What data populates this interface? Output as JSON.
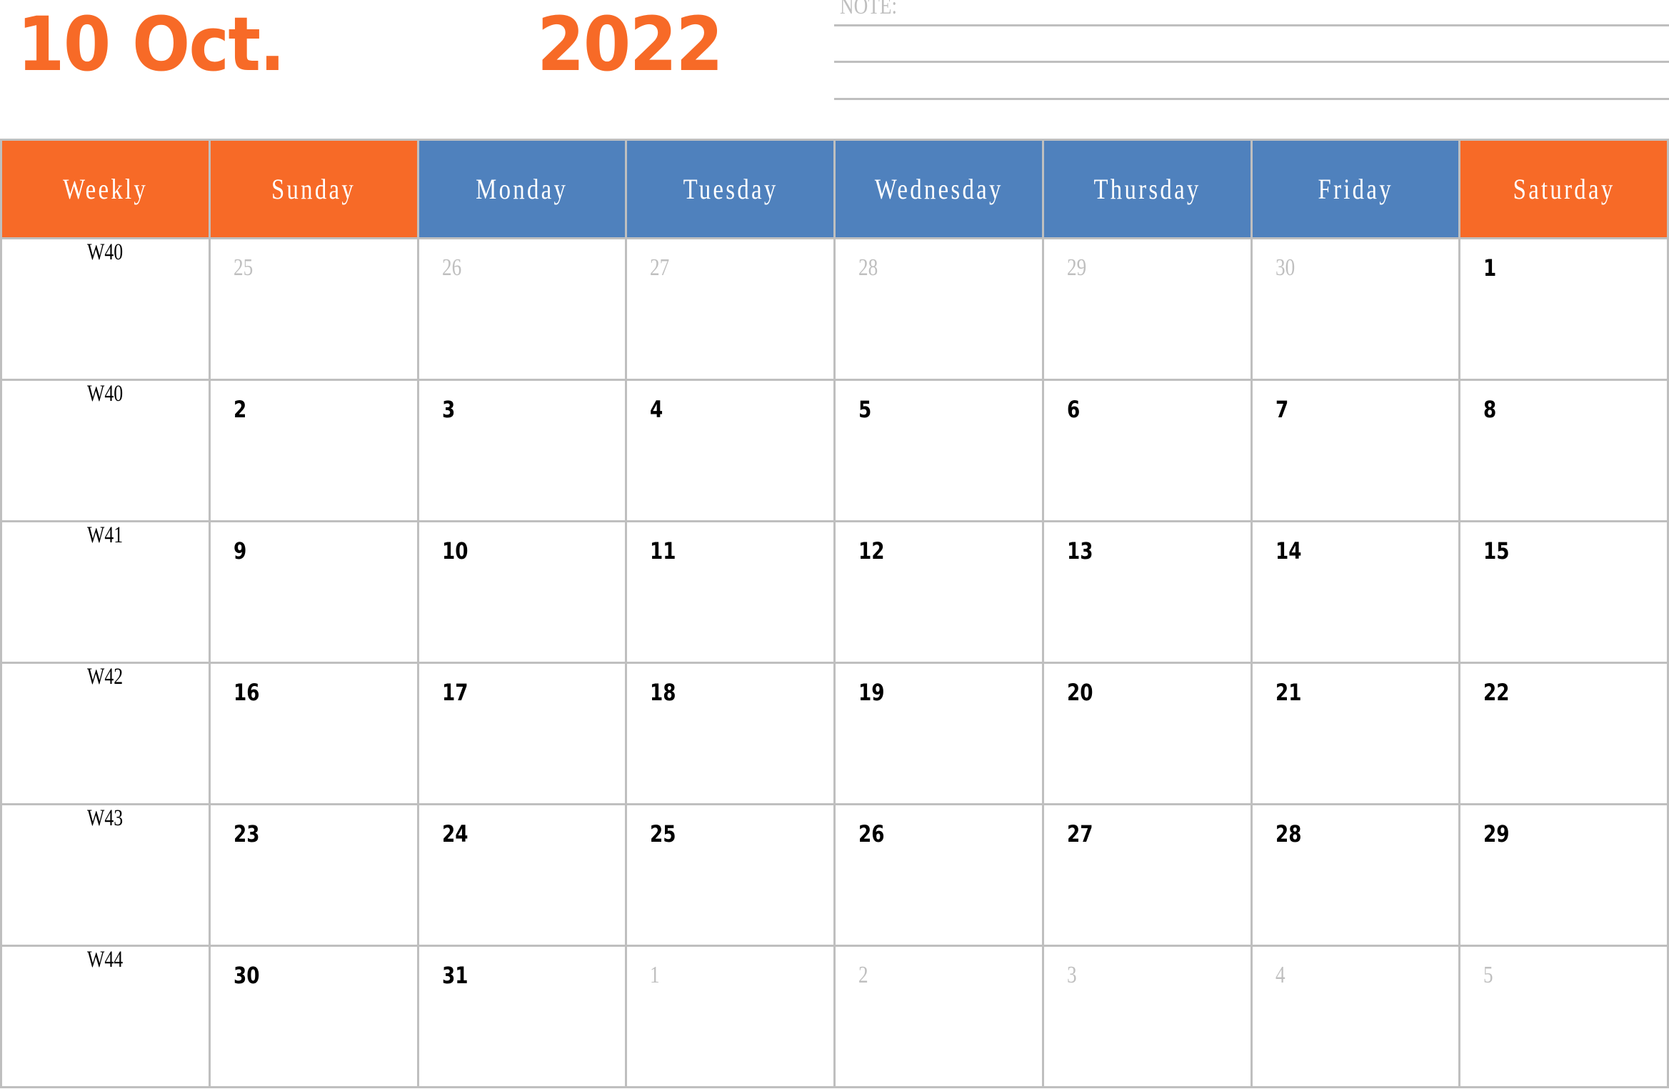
{
  "header": {
    "month_label": "10 Oct.",
    "year_label": "2022",
    "note_label": "NOTE:"
  },
  "colors": {
    "accent_orange": "#F76A27",
    "accent_blue": "#4F81BD",
    "grid_gray": "#BFBFBF",
    "out_of_month_text": "#BFBFBF"
  },
  "columns": [
    {
      "label": "Weekly",
      "color": "orange"
    },
    {
      "label": "Sunday",
      "color": "orange"
    },
    {
      "label": "Monday",
      "color": "blue"
    },
    {
      "label": "Tuesday",
      "color": "blue"
    },
    {
      "label": "Wednesday",
      "color": "blue"
    },
    {
      "label": "Thursday",
      "color": "blue"
    },
    {
      "label": "Friday",
      "color": "blue"
    },
    {
      "label": "Saturday",
      "color": "orange"
    }
  ],
  "weeks": [
    {
      "week": "W40",
      "days": [
        {
          "d": "25",
          "in_month": false
        },
        {
          "d": "26",
          "in_month": false
        },
        {
          "d": "27",
          "in_month": false
        },
        {
          "d": "28",
          "in_month": false
        },
        {
          "d": "29",
          "in_month": false
        },
        {
          "d": "30",
          "in_month": false
        },
        {
          "d": "1",
          "in_month": true
        }
      ]
    },
    {
      "week": "W40",
      "days": [
        {
          "d": "2",
          "in_month": true
        },
        {
          "d": "3",
          "in_month": true
        },
        {
          "d": "4",
          "in_month": true
        },
        {
          "d": "5",
          "in_month": true
        },
        {
          "d": "6",
          "in_month": true
        },
        {
          "d": "7",
          "in_month": true
        },
        {
          "d": "8",
          "in_month": true
        }
      ]
    },
    {
      "week": "W41",
      "days": [
        {
          "d": "9",
          "in_month": true
        },
        {
          "d": "10",
          "in_month": true
        },
        {
          "d": "11",
          "in_month": true
        },
        {
          "d": "12",
          "in_month": true
        },
        {
          "d": "13",
          "in_month": true
        },
        {
          "d": "14",
          "in_month": true
        },
        {
          "d": "15",
          "in_month": true
        }
      ]
    },
    {
      "week": "W42",
      "days": [
        {
          "d": "16",
          "in_month": true
        },
        {
          "d": "17",
          "in_month": true
        },
        {
          "d": "18",
          "in_month": true
        },
        {
          "d": "19",
          "in_month": true
        },
        {
          "d": "20",
          "in_month": true
        },
        {
          "d": "21",
          "in_month": true
        },
        {
          "d": "22",
          "in_month": true
        }
      ]
    },
    {
      "week": "W43",
      "days": [
        {
          "d": "23",
          "in_month": true
        },
        {
          "d": "24",
          "in_month": true
        },
        {
          "d": "25",
          "in_month": true
        },
        {
          "d": "26",
          "in_month": true
        },
        {
          "d": "27",
          "in_month": true
        },
        {
          "d": "28",
          "in_month": true
        },
        {
          "d": "29",
          "in_month": true
        }
      ]
    },
    {
      "week": "W44",
      "days": [
        {
          "d": "30",
          "in_month": true
        },
        {
          "d": "31",
          "in_month": true
        },
        {
          "d": "1",
          "in_month": false
        },
        {
          "d": "2",
          "in_month": false
        },
        {
          "d": "3",
          "in_month": false
        },
        {
          "d": "4",
          "in_month": false
        },
        {
          "d": "5",
          "in_month": false
        }
      ]
    }
  ]
}
